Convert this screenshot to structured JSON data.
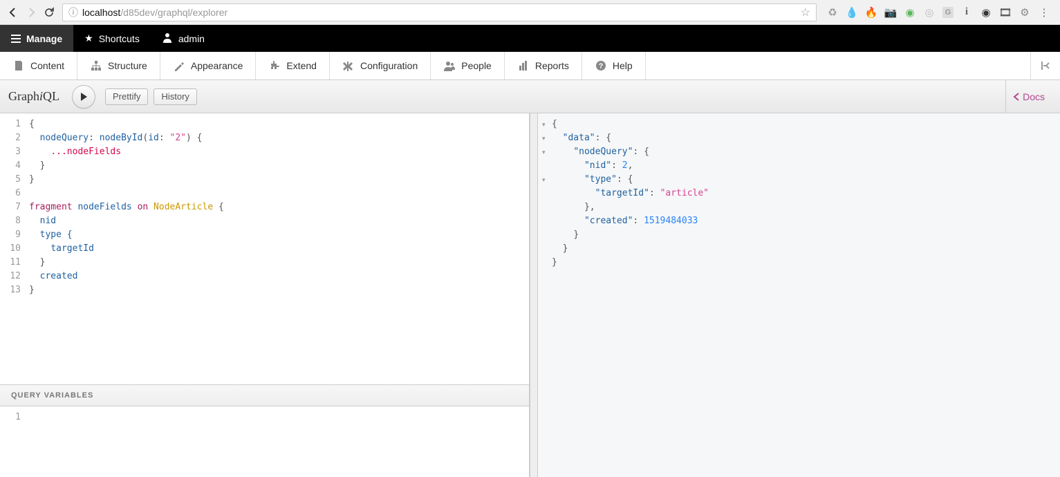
{
  "browser": {
    "url_host": "localhost",
    "url_path": "/d85dev/graphql/explorer"
  },
  "drupalTop": {
    "manage": "Manage",
    "shortcuts": "Shortcuts",
    "admin": "admin"
  },
  "drupalMenu": {
    "content": "Content",
    "structure": "Structure",
    "appearance": "Appearance",
    "extend": "Extend",
    "configuration": "Configuration",
    "people": "People",
    "reports": "Reports",
    "help": "Help"
  },
  "graphiql": {
    "title_prefix": "Graph",
    "title_i": "i",
    "title_suffix": "QL",
    "prettify": "Prettify",
    "history": "History",
    "docs": "Docs",
    "queryVariables": "Query Variables"
  },
  "query": {
    "lines": [
      "1",
      "2",
      "3",
      "4",
      "5",
      "6",
      "7",
      "8",
      "9",
      "10",
      "11",
      "12",
      "13"
    ],
    "l1_open": "{",
    "l2_fn": "nodeQuery",
    "l2_colon": ": ",
    "l2_call": "nodeById",
    "l2_paren": "(",
    "l2_arg": "id",
    "l2_argcolon": ": ",
    "l2_str": "\"2\"",
    "l2_close": ") {",
    "l3_spread": "...",
    "l3_frag": "nodeFields",
    "l4": "}",
    "l5": "}",
    "l7_kw": "fragment",
    "l7_name": "nodeFields",
    "l7_on": "on",
    "l7_type": "NodeArticle",
    "l7_open": " {",
    "l8": "nid",
    "l9": "type {",
    "l10": "targetId",
    "l11": "}",
    "l12": "created",
    "l13": "}"
  },
  "variables": {
    "line1": "1"
  },
  "result": {
    "open": "{",
    "k_data": "\"data\"",
    "colon": ": ",
    "brace_open": "{",
    "k_nodeQuery": "\"nodeQuery\"",
    "k_nid": "\"nid\"",
    "v_nid": "2",
    "comma": ",",
    "k_type": "\"type\"",
    "k_targetId": "\"targetId\"",
    "v_targetId": "\"article\"",
    "k_created": "\"created\"",
    "v_created": "1519484033",
    "brace_close": "}",
    "close": "}"
  },
  "chart_data": {
    "type": "table",
    "title": "GraphQL query result",
    "data": {
      "nodeQuery": {
        "nid": 2,
        "type": {
          "targetId": "article"
        },
        "created": 1519484033
      }
    }
  }
}
